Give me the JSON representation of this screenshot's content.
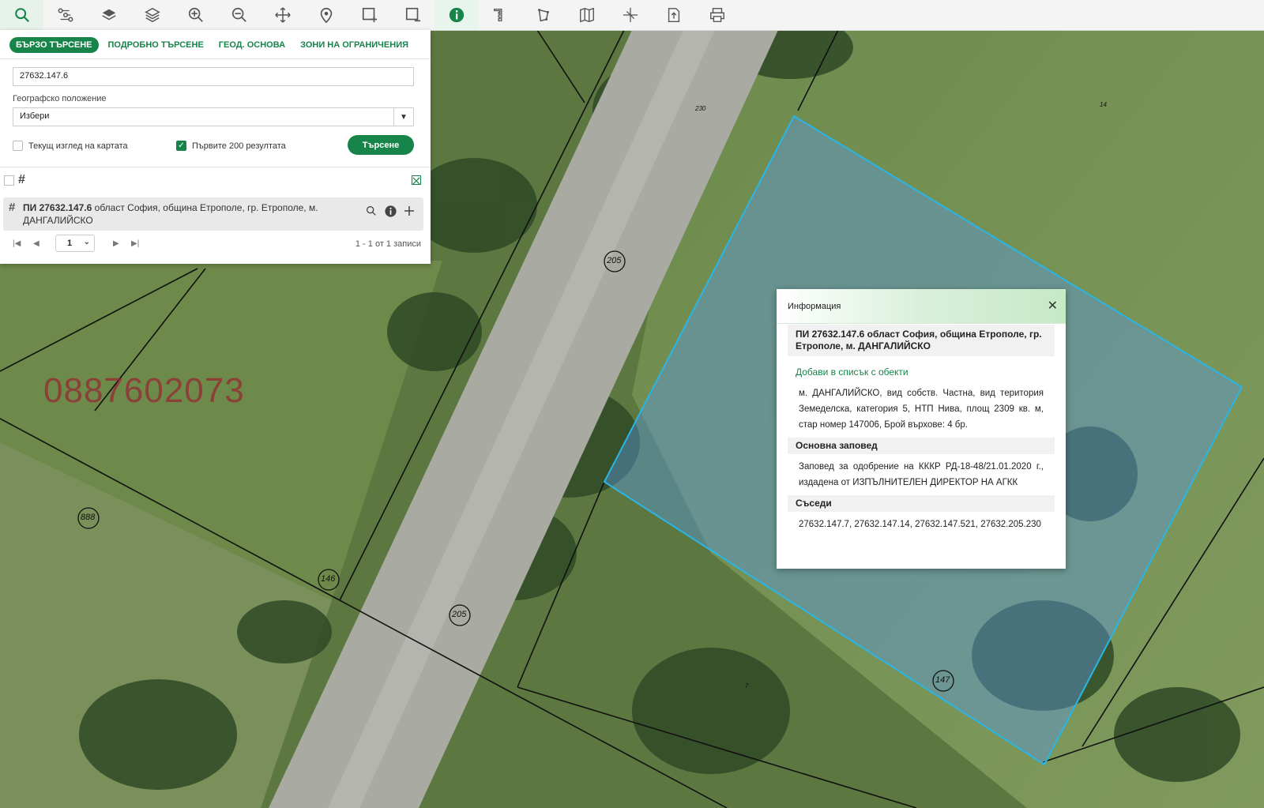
{
  "toolbar": {
    "tools": [
      "search-icon",
      "route-icon",
      "layer-icon",
      "layers-icon",
      "zoom-in-icon",
      "zoom-out-icon",
      "pan-icon",
      "location-pin-icon",
      "select-rect-icon",
      "select-clear-icon",
      "info-icon",
      "measure-icon",
      "polygon-icon",
      "map-icon",
      "crosshair-icon",
      "export-icon",
      "print-icon"
    ]
  },
  "search_panel": {
    "tabs": [
      "БЪРЗО ТЪРСЕНЕ",
      "ПОДРОБНО ТЪРСЕНЕ",
      "ГЕОД. ОСНОВА",
      "ЗОНИ НА ОГРАНИЧЕНИЯ"
    ],
    "query_value": "27632.147.6",
    "geo_label": "Географско положение",
    "geo_select": "Избери",
    "current_view_label": "Текущ изглед на картата",
    "current_view_checked": false,
    "first200_label": "Първите 200 резултата",
    "first200_checked": true,
    "search_button": "Търсене"
  },
  "results": {
    "items": [
      {
        "title": "ПИ 27632.147.6",
        "desc": "област София, община Етрополе, гр. Етрополе, м.",
        "desc2": "ДАНГАЛИЙСКО"
      }
    ],
    "page": "1",
    "count_text": "1 - 1 от 1 записи"
  },
  "popup": {
    "header": "Информация",
    "title": "ПИ 27632.147.6 област София, община Етрополе, гр. Етрополе, м. ДАНГАЛИЙСКО",
    "add_link": "Добави в списък с обекти",
    "details": "м. ДАНГАЛИЙСКО, вид собств. Частна, вид територия Земеделска, категория 5, НТП Нива, площ 2309 кв. м, стар номер 147006, Брой върхове: 4 бр.",
    "order_title": "Основна заповед",
    "order_text": "Заповед за одобрение на КККР РД-18-48/21.01.2020 г., издадена от ИЗПЪЛНИТЕЛЕН ДИРЕКТОР НА АГКК",
    "neighbors_title": "Съседи",
    "neighbors_text": "27632.147.7, 27632.147.14, 27632.147.521, 27632.205.230"
  },
  "map": {
    "phone_overlay": "0887602073",
    "labels": {
      "l205a": "205",
      "l205b": "205",
      "l888": "888",
      "l146": "146",
      "l147": "147",
      "l230": "230",
      "l14": "14",
      "l7": "7"
    },
    "highlight_color": "#29b6e6"
  }
}
